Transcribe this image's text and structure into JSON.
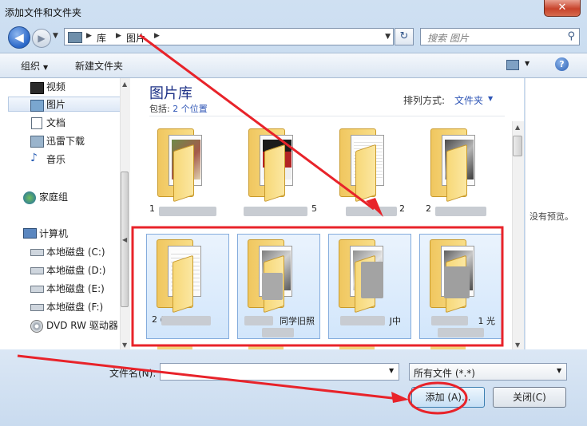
{
  "window": {
    "title": "添加文件和文件夹",
    "close_symbol": "✕"
  },
  "nav": {
    "back_symbol": "◀",
    "forward_symbol": "▶",
    "breadcrumb": [
      "库",
      "图片"
    ],
    "refresh_symbol": "↻",
    "search_placeholder": "搜索 图片",
    "search_icon": "search-icon"
  },
  "toolbar": {
    "organize": "组织",
    "new_folder": "新建文件夹",
    "help": "?"
  },
  "sidebar": {
    "items": [
      {
        "label": "视频",
        "icon": "video-library-icon"
      },
      {
        "label": "图片",
        "icon": "pictures-library-icon",
        "selected": true
      },
      {
        "label": "文档",
        "icon": "documents-library-icon"
      },
      {
        "label": "迅雷下载",
        "icon": "download-folder-icon"
      },
      {
        "label": "音乐",
        "icon": "music-library-icon"
      },
      {
        "label": "家庭组",
        "icon": "homegroup-icon"
      },
      {
        "label": "计算机",
        "icon": "computer-icon"
      },
      {
        "label": "本地磁盘 (C:)",
        "icon": "hard-drive-icon"
      },
      {
        "label": "本地磁盘 (D:)",
        "icon": "hard-drive-icon"
      },
      {
        "label": "本地磁盘 (E:)",
        "icon": "hard-drive-icon"
      },
      {
        "label": "本地磁盘 (F:)",
        "icon": "hard-drive-icon"
      },
      {
        "label": "DVD RW 驱动器",
        "icon": "dvd-drive-icon"
      }
    ]
  },
  "library": {
    "title": "图片库",
    "includes_prefix": "包括:",
    "includes_link": "2 个位置",
    "arrange_label": "排列方式:",
    "arrange_value": "文件夹"
  },
  "folders_row1": [
    {
      "label": "1"
    },
    {
      "label": "5"
    },
    {
      "label": "2"
    },
    {
      "label": "2"
    }
  ],
  "folders_row2": [
    {
      "label": "2                ("
    },
    {
      "label": "同学旧照"
    },
    {
      "label": "J中"
    },
    {
      "label": "1  光"
    }
  ],
  "preview": {
    "text": "没有预览。"
  },
  "bottom": {
    "filename_label": "文件名(N):",
    "filename_value": "",
    "filetype_value": "所有文件 (*.*)",
    "add_button": "添加 (A)...",
    "close_button": "关闭(C)"
  },
  "colors": {
    "annotation": "#e8232a",
    "accent": "#2f56b6"
  }
}
